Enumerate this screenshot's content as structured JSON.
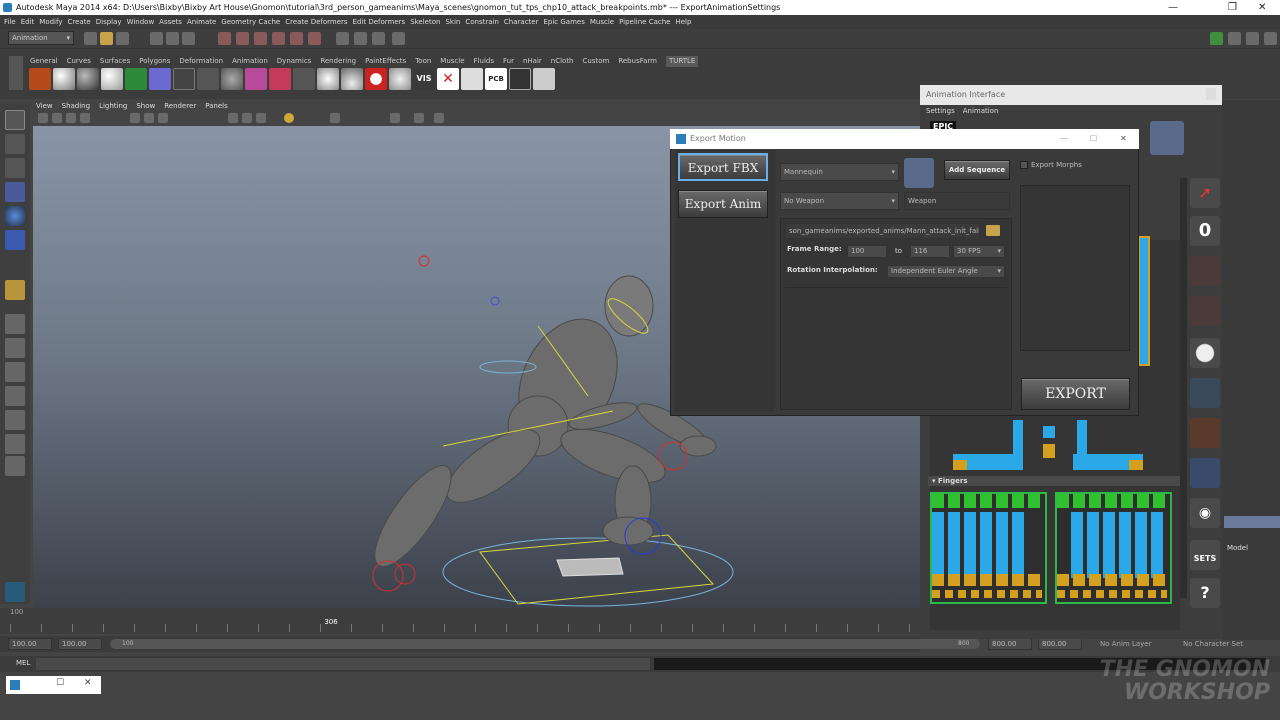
{
  "window": {
    "title": "Autodesk Maya 2014 x64: D:\\Users\\Bixby\\Bixby Art House\\Gnomon\\tutorial\\3rd_person_gameanims\\Maya_scenes\\gnomon_tut_tps_chp10_attack_breakpoints.mb*  ---  ExportAnimationSettings",
    "min": "—",
    "max": "❐",
    "close": "✕"
  },
  "menu": [
    "File",
    "Edit",
    "Modify",
    "Create",
    "Display",
    "Window",
    "Assets",
    "Animate",
    "Geometry Cache",
    "Create Deformers",
    "Edit Deformers",
    "Skeleton",
    "Skin",
    "Constrain",
    "Character",
    "Epic Games",
    "Muscle",
    "Pipeline Cache",
    "Help"
  ],
  "mode_select": "Animation",
  "shelf_tabs": [
    "General",
    "Curves",
    "Surfaces",
    "Polygons",
    "Deformation",
    "Animation",
    "Dynamics",
    "Rendering",
    "PaintEffects",
    "Toon",
    "Muscle",
    "Fluids",
    "Fur",
    "nHair",
    "nCloth",
    "Custom",
    "RebusFarm",
    "TURTLE"
  ],
  "shelf_icon_labels": {
    "vis": "VIS",
    "pcb": "PCB"
  },
  "viewport_menu": [
    "View",
    "Shading",
    "Lighting",
    "Show",
    "Renderer",
    "Panels"
  ],
  "timeline": {
    "ticks": [
      "100",
      "",
      "",
      "",
      "",
      "",
      "",
      "306",
      "",
      "",
      "",
      "",
      "",
      "",
      "",
      "",
      "",
      "",
      "",
      "",
      "",
      "",
      ""
    ],
    "current_frame": "306"
  },
  "range": {
    "start": "100.00",
    "start2": "100.00",
    "slider_start": "100",
    "slider_end": "800",
    "end": "800.00",
    "end2": "800.00",
    "anim_layer": "No Anim Layer",
    "char_set": "No Character Set"
  },
  "mel_label": "MEL",
  "anim_interface": {
    "title": "Animation Interface",
    "tabs": [
      "Settings",
      "Animation"
    ],
    "logo": "EPIC",
    "fingers_label": "Fingers"
  },
  "right_buttons": {
    "zero": "0",
    "sets": "SETS",
    "help": "?"
  },
  "outliner_item": "Model",
  "export": {
    "title": "Export Motion",
    "export_fbx": "Export FBX",
    "export_anim": "Export Anim",
    "character": "Mannequin",
    "weapon_select": "No Weapon",
    "weapon_field": "Weapon",
    "add_sequence": "Add Sequence",
    "export_morphs": "Export Morphs",
    "path": "son_gameanims/exported_anims/Mann_attack_init_fail.fbx",
    "frame_range_label": "Frame Range:",
    "range_from": "100",
    "to_label": "to",
    "range_to": "116",
    "fps": "30 FPS",
    "rot_label": "Rotation Interpolation:",
    "rot_value": "Independent Euler Angle",
    "export_button": "EXPORT"
  },
  "watermark": {
    "line1": "THE GNOMON",
    "line2": "WORKSHOP"
  }
}
